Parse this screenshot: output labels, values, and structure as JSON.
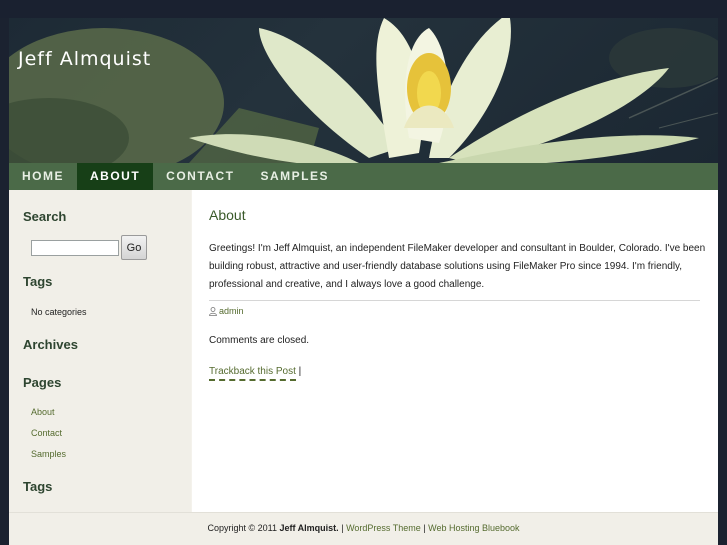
{
  "site": {
    "title": "Jeff Almquist"
  },
  "nav": {
    "home": "HOME",
    "about": "ABOUT",
    "contact": "CONTACT",
    "samples": "SAMPLES"
  },
  "sidebar": {
    "search_heading": "Search",
    "search_value": "",
    "search_button": "Go",
    "tags_heading": "Tags",
    "tags_text": "No categories",
    "archives_heading": "Archives",
    "pages_heading": "Pages",
    "pages": [
      "About",
      "Contact",
      "Samples"
    ],
    "tags_heading_2": "Tags"
  },
  "post": {
    "title": "About",
    "body": "Greetings! I'm Jeff Almquist, an independent FileMaker developer and consultant in Boulder, Colorado. I've been building robust, attractive and user-friendly database solutions using FileMaker Pro since 1994. I'm friendly, professional and creative, and I always love a good challenge.",
    "author": "admin",
    "comments": "Comments are closed.",
    "trackback": "Trackback this Post",
    "trackback_sep": "|"
  },
  "footer": {
    "copyright": "Copyright © 2011",
    "owner": "Jeff Almquist.",
    "sep1": "|",
    "theme_link": "WordPress Theme",
    "sep2": "|",
    "hosting_link": "Web Hosting Bluebook"
  },
  "colors": {
    "nav_bg": "#4b6a48",
    "nav_active": "#173f17",
    "link": "#556b2f"
  }
}
